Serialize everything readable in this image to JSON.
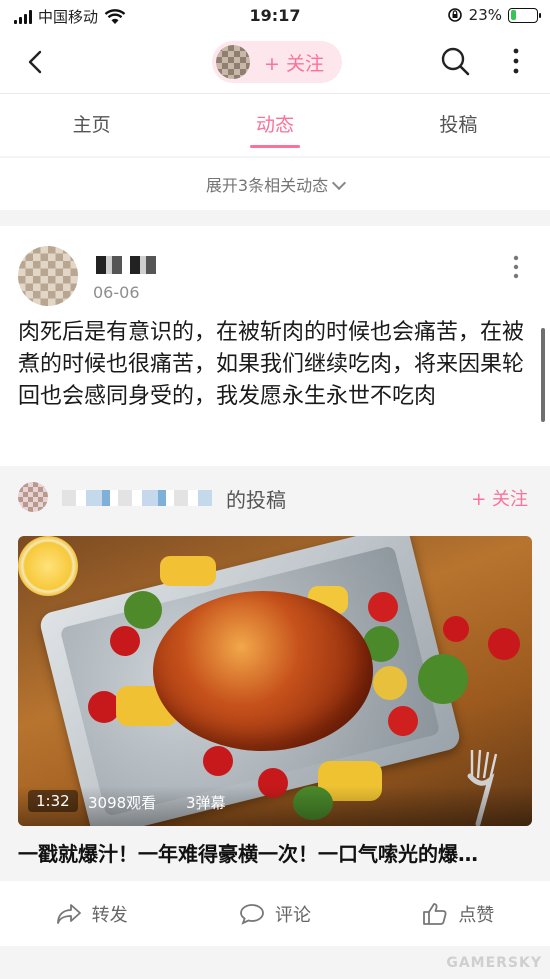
{
  "status_bar": {
    "carrier": "中国移动",
    "time": "19:17",
    "battery_pct": "23%",
    "battery_level": 0.23,
    "battery_color": "#35c659"
  },
  "nav": {
    "back_icon": "chevron-left-icon",
    "follow_label": "+ 关注",
    "search_icon": "search-icon",
    "more_icon": "more-vertical-icon"
  },
  "tabs": [
    {
      "label": "主页",
      "active": false
    },
    {
      "label": "动态",
      "active": true
    },
    {
      "label": "投稿",
      "active": false
    }
  ],
  "expand_label": "展开3条相关动态",
  "post": {
    "date": "06-06",
    "text": "肉死后是有意识的，在被斩肉的时候也会痛苦，在被煮的时候也很痛苦，如果我们继续吃肉，将来因果轮回也会感同身受的，我发愿永生永世不吃肉",
    "repost": {
      "suffix": "的投稿",
      "follow_label": "+ 关注",
      "video": {
        "duration": "1:32",
        "views": "3098观看",
        "danmaku": "3弹幕",
        "title": "一戳就爆汁！一年难得豪横一次！一口气嗦光的爆…"
      }
    },
    "actions": [
      {
        "label": "转发",
        "icon": "share-icon"
      },
      {
        "label": "评论",
        "icon": "comment-icon"
      },
      {
        "label": "点赞",
        "icon": "thumbs-up-icon"
      }
    ]
  },
  "watermark": "GAMERSKY",
  "accent_color": "#fb7299"
}
